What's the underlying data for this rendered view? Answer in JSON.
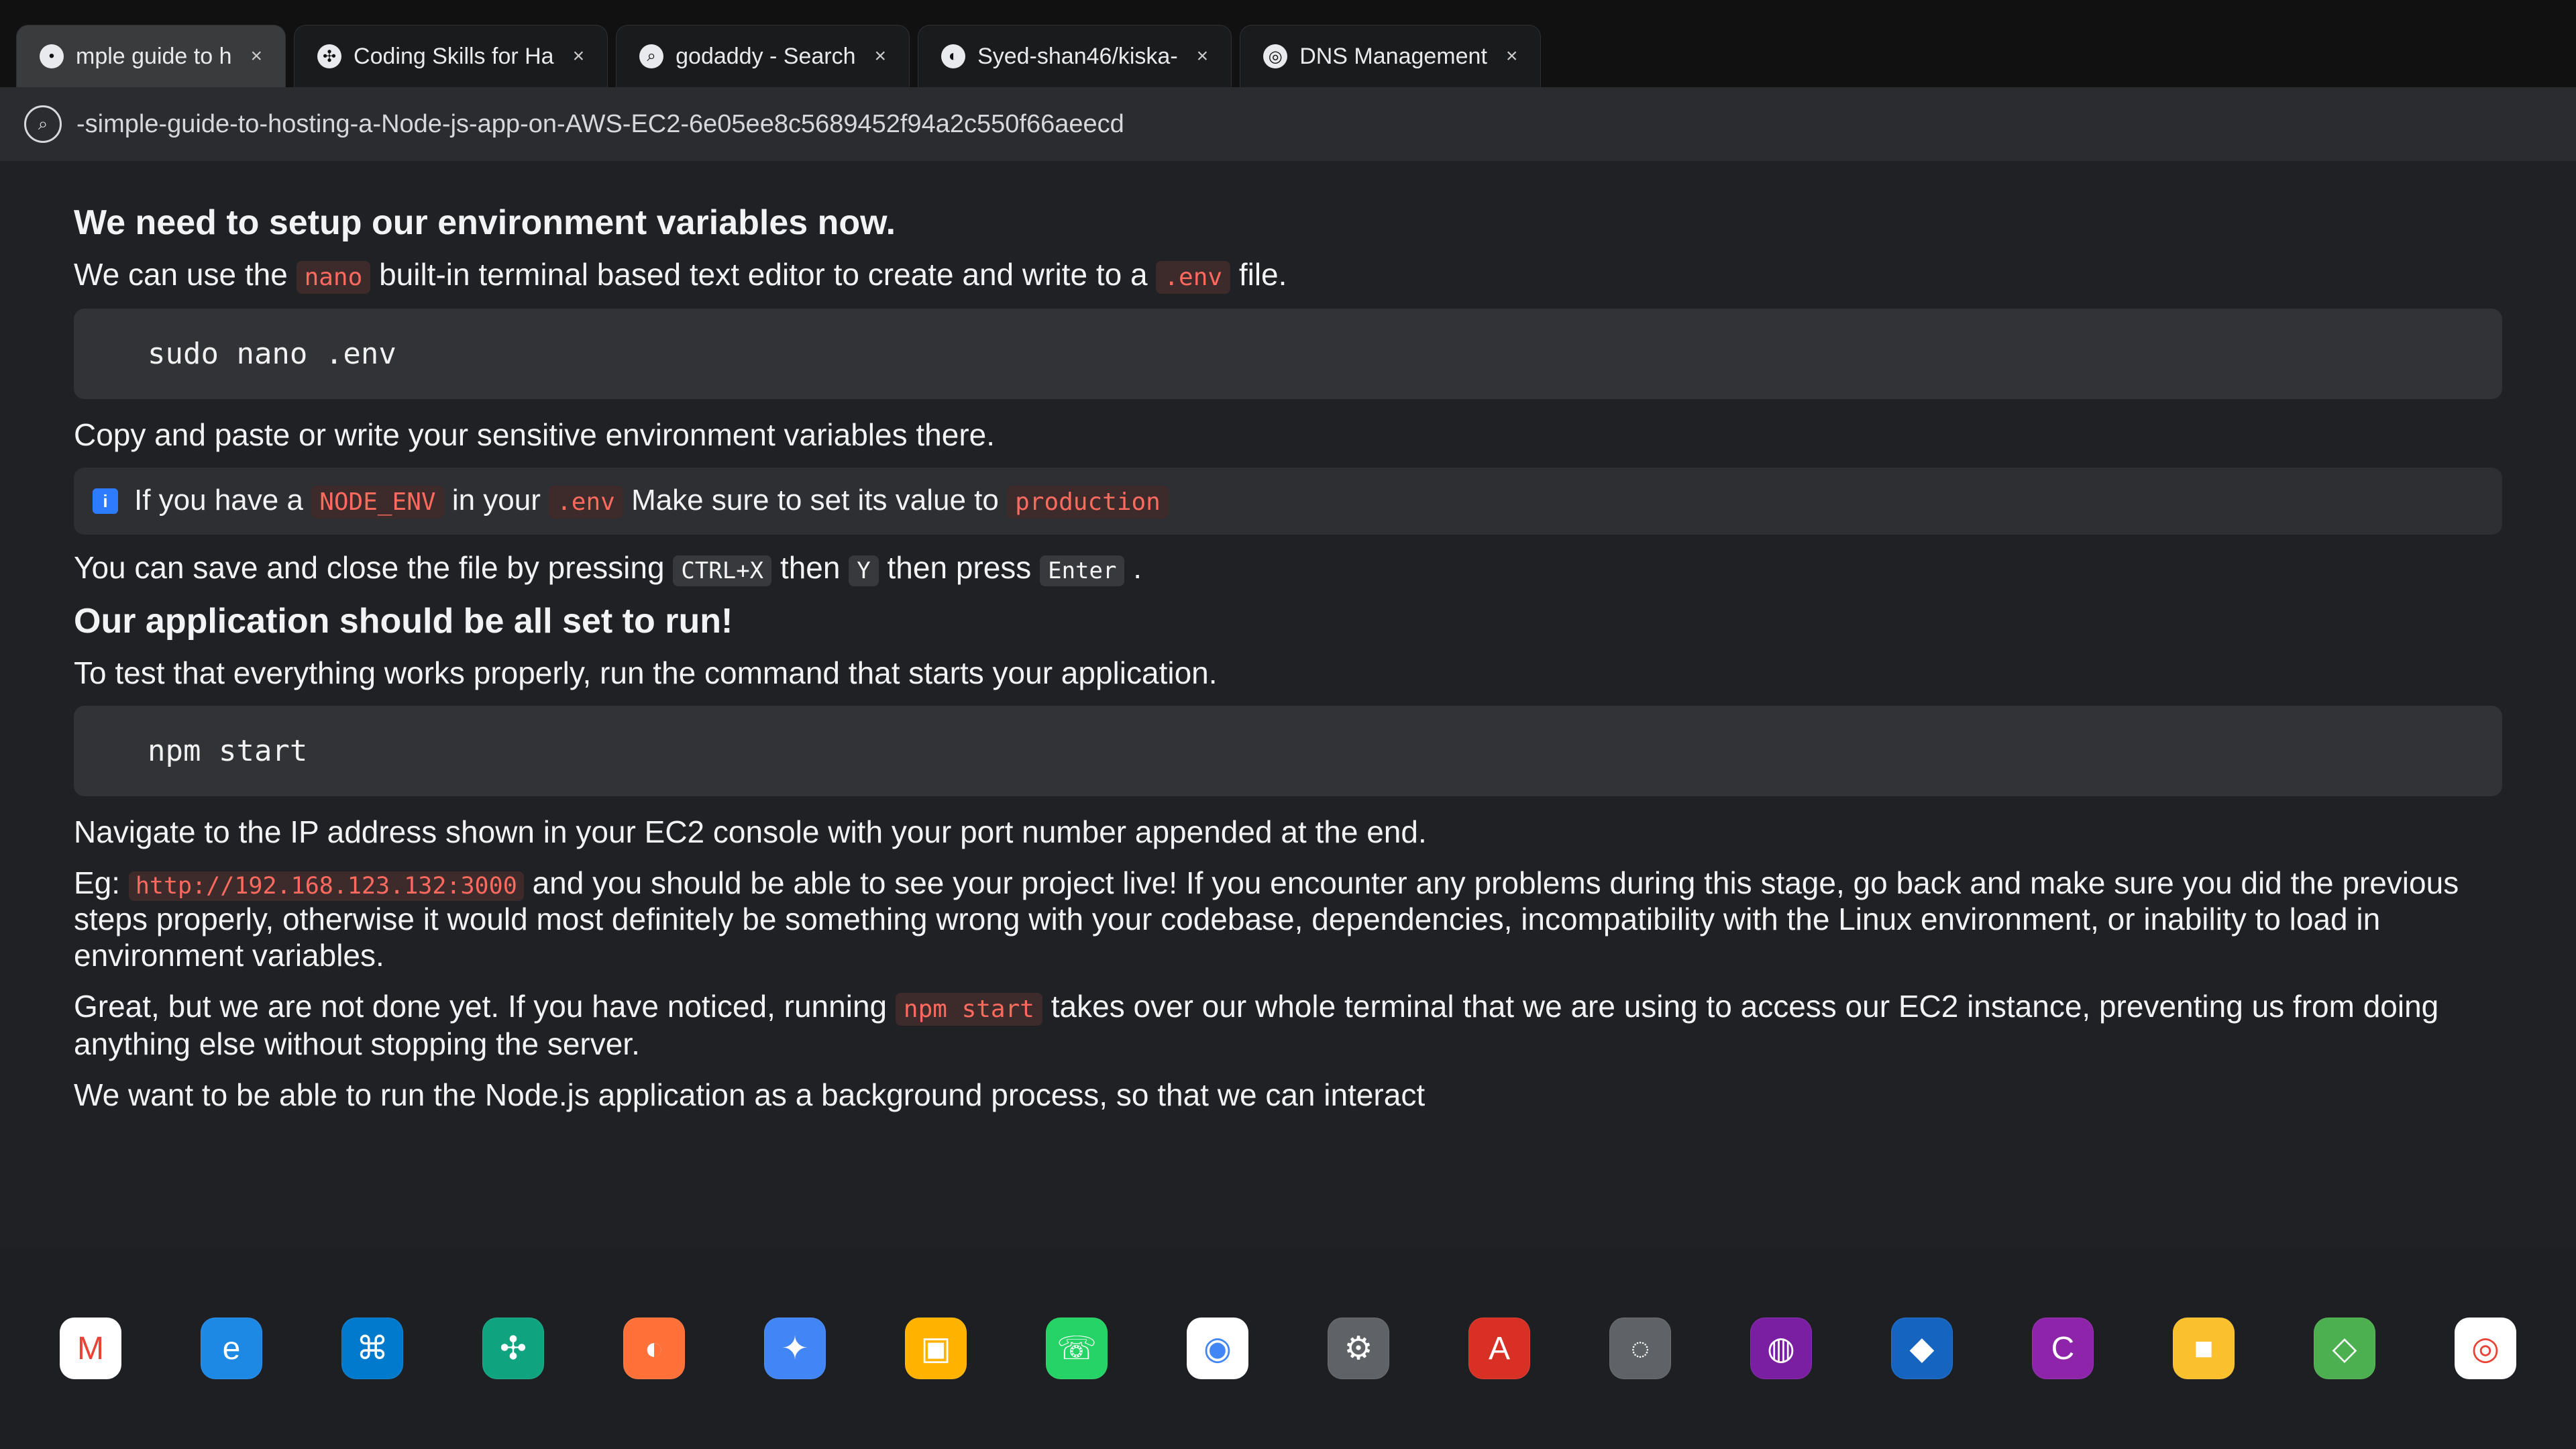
{
  "tabs": [
    {
      "label": "mple guide to h",
      "icon": "page-icon"
    },
    {
      "label": "Coding Skills for Ha",
      "icon": "openai-icon"
    },
    {
      "label": "godaddy - Search",
      "icon": "search-icon"
    },
    {
      "label": "Syed-shan46/kiska-",
      "icon": "github-icon"
    },
    {
      "label": "DNS Management",
      "icon": "godaddy-icon"
    }
  ],
  "address": {
    "url": "-simple-guide-to-hosting-a-Node-js-app-on-AWS-EC2-6e05ee8c5689452f94a2c550f66aeecd"
  },
  "content": {
    "heading1": "We need to setup our environment variables now.",
    "line1_a": "We can use the",
    "line1_code": "nano",
    "line1_b": "built-in terminal based text editor to create and write to a",
    "line1_code2": ".env",
    "line1_c": "file.",
    "command1": "sudo nano .env",
    "line2": "Copy and paste or write your sensitive environment variables there.",
    "note_text_a": "If you have a",
    "note_code1": "NODE_ENV",
    "note_text_b": "in your",
    "note_code2": ".env",
    "note_text_c": "Make sure to set its value to",
    "note_code3": "production",
    "save_text_a": "You can save and close the file by pressing",
    "save_kbd1": "CTRL+X",
    "save_text_b": "then",
    "save_kbd2": "Y",
    "save_text_c": "then press",
    "save_kbd3": "Enter",
    "save_text_d": ".",
    "heading2": "Our application should be all set to run!",
    "test_text": "To test that everything works properly, run the command that starts your application.",
    "command2": "npm start",
    "para1_a": "Navigate to the IP address shown in your EC2 console with your port number appended at the end.",
    "para1_b": "Eg:",
    "para1_url": "http://192.168.123.132:3000",
    "para1_c": "and you should be able to see your project live! If you encounter any problems during this stage, go back and make sure you did the previous steps properly, otherwise it would most definitely be something wrong with your codebase, dependencies, incompatibility with the Linux environment, or inability to load in environment variables.",
    "para2_a": "Great, but we are not done yet. If you have noticed, running",
    "para2_code": "npm start",
    "para2_b": "takes over our whole terminal that we are using to access our EC2 instance, preventing us from doing anything else without stopping the server.",
    "para3": "We want to be able to run the Node.js application as a background process, so that we can interact"
  },
  "taskbar": [
    {
      "name": "gmail-icon",
      "glyph": "M",
      "bg": "#ffffff",
      "fg": "#ea4335"
    },
    {
      "name": "edge-icon",
      "glyph": "e",
      "bg": "#1e88e5",
      "fg": "#ffffff"
    },
    {
      "name": "vscode-icon",
      "glyph": "⌘",
      "bg": "#007acc",
      "fg": "#ffffff"
    },
    {
      "name": "chatgpt-icon",
      "glyph": "✣",
      "bg": "#10a37f",
      "fg": "#ffffff"
    },
    {
      "name": "firefox-icon",
      "glyph": "◐",
      "bg": "#ff7139",
      "fg": "#ffffff"
    },
    {
      "name": "gemini-icon",
      "glyph": "✦",
      "bg": "#4285f4",
      "fg": "#ffffff"
    },
    {
      "name": "files-icon",
      "glyph": "▣",
      "bg": "#ffb300",
      "fg": "#ffffff"
    },
    {
      "name": "whatsapp-icon",
      "glyph": "☏",
      "bg": "#25d366",
      "fg": "#ffffff"
    },
    {
      "name": "chrome-icon",
      "glyph": "◉",
      "bg": "#ffffff",
      "fg": "#4285f4"
    },
    {
      "name": "settings-icon",
      "glyph": "⚙",
      "bg": "#5f6368",
      "fg": "#ffffff"
    },
    {
      "name": "acrobat-icon",
      "glyph": "A",
      "bg": "#d93025",
      "fg": "#ffffff"
    },
    {
      "name": "compass-icon",
      "glyph": "◌",
      "bg": "#5f6368",
      "fg": "#ffffff"
    },
    {
      "name": "team-icon",
      "glyph": "◍",
      "bg": "#7b1fa2",
      "fg": "#ffffff"
    },
    {
      "name": "azure-icon",
      "glyph": "◆",
      "bg": "#1565c0",
      "fg": "#ffffff"
    },
    {
      "name": "canva-icon",
      "glyph": "C",
      "bg": "#8e24aa",
      "fg": "#ffffff"
    },
    {
      "name": "note-icon",
      "glyph": "■",
      "bg": "#fbc02d",
      "fg": "#ffffff"
    },
    {
      "name": "kite-icon",
      "glyph": "◇",
      "bg": "#4caf50",
      "fg": "#ffffff"
    },
    {
      "name": "chrome-profile-icon",
      "glyph": "◎",
      "bg": "#ffffff",
      "fg": "#ea4335"
    }
  ]
}
